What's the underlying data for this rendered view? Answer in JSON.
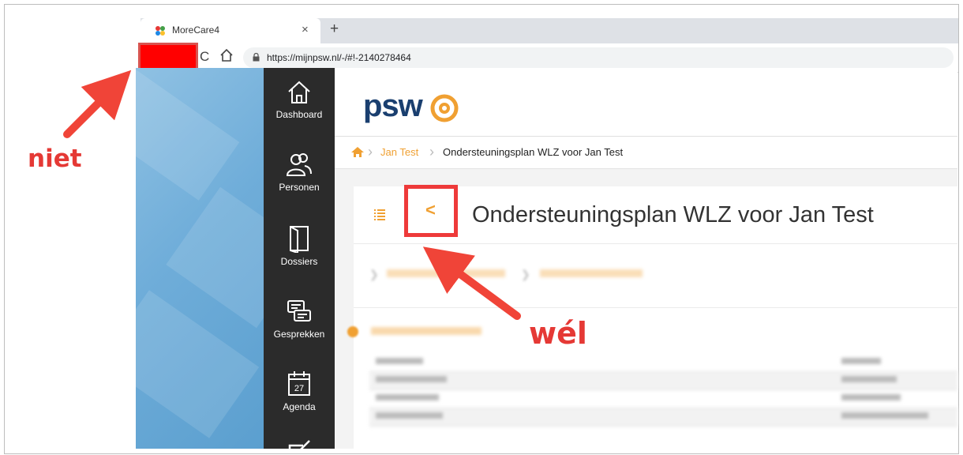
{
  "browser": {
    "tab_title": "MoreCare4",
    "tab_close": "×",
    "new_tab": "+",
    "reload_icon": "C",
    "url": "https://mijnpsw.nl/-/#!-2140278464"
  },
  "sidenav": {
    "items": [
      {
        "label": "Dashboard",
        "icon": "home-icon"
      },
      {
        "label": "Personen",
        "icon": "people-icon"
      },
      {
        "label": "Dossiers",
        "icon": "book-icon"
      },
      {
        "label": "Gesprekken",
        "icon": "chat-icon"
      },
      {
        "label": "Agenda",
        "icon": "calendar-icon",
        "day": "27"
      },
      {
        "label": "",
        "icon": "edit-icon"
      }
    ]
  },
  "header": {
    "logo_text": "psw"
  },
  "breadcrumb": {
    "link": "Jan Test",
    "current": "Ondersteuningsplan WLZ voor Jan Test"
  },
  "page": {
    "title": "Ondersteuningsplan WLZ voor Jan Test",
    "back_icon": "<"
  },
  "annotations": {
    "niet": "niet",
    "wel": "wél"
  },
  "colors": {
    "accent": "#f0a032",
    "sidenav": "#2b2b2b",
    "annotation": "#e53935",
    "logo": "#1a3f6f"
  }
}
